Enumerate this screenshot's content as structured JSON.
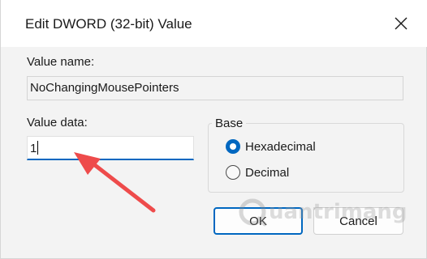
{
  "dialog": {
    "title": "Edit DWORD (32-bit) Value",
    "value_name_label": "Value name:",
    "value_name": "NoChangingMousePointers",
    "value_data_label": "Value data:",
    "value_data": "1",
    "base": {
      "title": "Base",
      "options": [
        {
          "label": "Hexadecimal",
          "selected": true
        },
        {
          "label": "Decimal",
          "selected": false
        }
      ]
    },
    "ok_label": "OK",
    "cancel_label": "Cancel"
  },
  "colors": {
    "accent": "#0067c0",
    "arrow": "#ee4b4b",
    "background": "#f3f3f3"
  },
  "watermark": {
    "text": "uantrimang"
  },
  "icons": {
    "close": "close-icon",
    "annotation": "red-arrow-icon",
    "watermark_logo": "quantrimang-logo-icon"
  }
}
